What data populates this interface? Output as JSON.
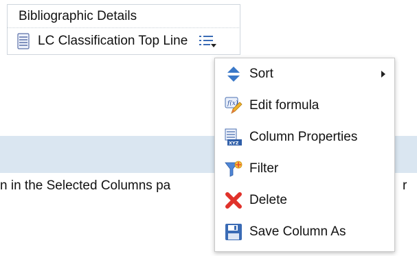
{
  "header": {
    "title": "Bibliographic Details"
  },
  "column": {
    "label": "LC Classification Top Line"
  },
  "instruction": {
    "text_left": "n in the Selected Columns pa",
    "text_right": "r"
  },
  "menu": {
    "items": [
      {
        "label": "Sort",
        "icon": "sort-icon",
        "has_submenu": true
      },
      {
        "label": "Edit formula",
        "icon": "edit-formula-icon"
      },
      {
        "label": "Column Properties",
        "icon": "column-properties-icon"
      },
      {
        "label": "Filter",
        "icon": "filter-icon"
      },
      {
        "label": "Delete",
        "icon": "delete-icon"
      },
      {
        "label": "Save Column As",
        "icon": "save-icon"
      }
    ]
  },
  "colors": {
    "accent_blue": "#3a78c8",
    "band": "#dae6f1",
    "delete_red": "#e0322b"
  }
}
